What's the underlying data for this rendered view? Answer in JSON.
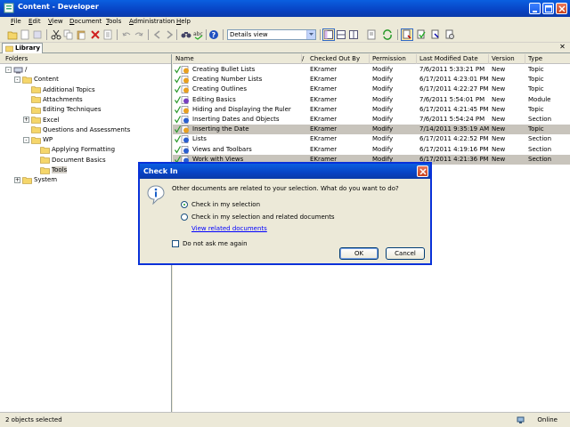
{
  "window": {
    "title": "Content - Developer"
  },
  "menu": [
    {
      "label": "File",
      "key": "F",
      "rest": "ile"
    },
    {
      "label": "Edit",
      "key": "E",
      "rest": "dit"
    },
    {
      "label": "View",
      "key": "V",
      "rest": "iew"
    },
    {
      "label": "Document",
      "key": "D",
      "rest": "ocument"
    },
    {
      "label": "Tools",
      "key": "T",
      "rest": "ools"
    },
    {
      "label": "Administration",
      "key": "A",
      "rest": "dministration"
    },
    {
      "label": "Help",
      "key": "H",
      "rest": "elp"
    }
  ],
  "toolbar": {
    "view_select": "Details view"
  },
  "tabs": {
    "library": "Library"
  },
  "folders": {
    "header": "Folders",
    "tree": [
      {
        "label": "/",
        "level": 0,
        "expander": "-"
      },
      {
        "label": "Content",
        "level": 1,
        "expander": "-"
      },
      {
        "label": "Additional Topics",
        "level": 2,
        "expander": ""
      },
      {
        "label": "Attachments",
        "level": 2,
        "expander": ""
      },
      {
        "label": "Editing Techniques",
        "level": 2,
        "expander": ""
      },
      {
        "label": "Excel",
        "level": 2,
        "expander": "+"
      },
      {
        "label": "Questions and Assessments",
        "level": 2,
        "expander": ""
      },
      {
        "label": "WP",
        "level": 2,
        "expander": "-"
      },
      {
        "label": "Applying Formatting",
        "level": 3,
        "expander": ""
      },
      {
        "label": "Document Basics",
        "level": 3,
        "expander": ""
      },
      {
        "label": "Tools",
        "level": 3,
        "expander": "",
        "selected": true
      },
      {
        "label": "System",
        "level": 1,
        "expander": "+"
      }
    ]
  },
  "documents": {
    "columns": [
      "Name",
      "/",
      "Checked Out By",
      "Permission",
      "Last Modified Date",
      "Version",
      "Type"
    ],
    "rows": [
      {
        "name": "Creating Bullet Lists",
        "checked_out_by": "EKramer",
        "permission": "Modify",
        "modified": "7/6/2011 5:33:21 PM",
        "version": "New",
        "type": "Topic",
        "selected": false
      },
      {
        "name": "Creating Number Lists",
        "checked_out_by": "EKramer",
        "permission": "Modify",
        "modified": "6/17/2011 4:23:01 PM",
        "version": "New",
        "type": "Topic",
        "selected": false
      },
      {
        "name": "Creating Outlines",
        "checked_out_by": "EKramer",
        "permission": "Modify",
        "modified": "6/17/2011 4:22:27 PM",
        "version": "New",
        "type": "Topic",
        "selected": false
      },
      {
        "name": "Editing Basics",
        "checked_out_by": "EKramer",
        "permission": "Modify",
        "modified": "7/6/2011 5:54:01 PM",
        "version": "New",
        "type": "Module",
        "selected": false
      },
      {
        "name": "Hiding and Displaying the Ruler",
        "checked_out_by": "EKramer",
        "permission": "Modify",
        "modified": "6/17/2011 4:21:45 PM",
        "version": "New",
        "type": "Topic",
        "selected": false
      },
      {
        "name": "Inserting Dates and Objects",
        "checked_out_by": "EKramer",
        "permission": "Modify",
        "modified": "7/6/2011 5:54:24 PM",
        "version": "New",
        "type": "Section",
        "selected": false
      },
      {
        "name": "Inserting the Date",
        "checked_out_by": "EKramer",
        "permission": "Modify",
        "modified": "7/14/2011 9:35:19 AM",
        "version": "New",
        "type": "Topic",
        "selected": true
      },
      {
        "name": "Lists",
        "checked_out_by": "EKramer",
        "permission": "Modify",
        "modified": "6/17/2011 4:22:52 PM",
        "version": "New",
        "type": "Section",
        "selected": false
      },
      {
        "name": "Views and Toolbars",
        "checked_out_by": "EKramer",
        "permission": "Modify",
        "modified": "6/17/2011 4:19:16 PM",
        "version": "New",
        "type": "Section",
        "selected": false
      },
      {
        "name": "Work with Views",
        "checked_out_by": "EKramer",
        "permission": "Modify",
        "modified": "6/17/2011 4:21:36 PM",
        "version": "New",
        "type": "Section",
        "selected": true
      }
    ]
  },
  "status": {
    "selected_count": "2 objects selected",
    "connection": "Online"
  },
  "dialog": {
    "title": "Check In",
    "question": "Other documents are related to your selection. What do you want to do?",
    "option1": "Check in my selection",
    "option2": "Check in my selection and related documents",
    "link": "View related documents",
    "checkbox": "Do not ask me again",
    "ok": "OK",
    "cancel": "Cancel"
  },
  "colors": {
    "title_blue": "#0843c4",
    "selection_gray": "#c8c4bc",
    "folder_yellow": "#f5d66b"
  }
}
